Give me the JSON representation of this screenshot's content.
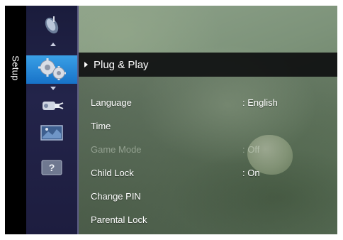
{
  "side_label": "Setup",
  "sidebar": {
    "icons": [
      {
        "name": "satellite-dish-icon",
        "active": false
      },
      {
        "name": "gears-icon",
        "active": true
      },
      {
        "name": "input-plug-icon",
        "active": false
      },
      {
        "name": "support-screen-icon",
        "active": false
      },
      {
        "name": "help-question-icon",
        "active": false,
        "glyph": "?"
      }
    ]
  },
  "menu": {
    "title": "Plug & Play",
    "items": [
      {
        "label": "Language",
        "value": ": English",
        "enabled": true
      },
      {
        "label": "Time",
        "value": "",
        "enabled": true
      },
      {
        "label": "Game Mode",
        "value": ": Off",
        "enabled": false
      },
      {
        "label": "Child Lock",
        "value": ": On",
        "enabled": true
      },
      {
        "label": "Change PIN",
        "value": "",
        "enabled": true
      },
      {
        "label": "Parental Lock",
        "value": "",
        "enabled": true
      }
    ]
  },
  "colors": {
    "active_icon_bg": "#1f86d8",
    "header_bg": "#0a0a0c",
    "icon_column_bg": "#1f2044"
  }
}
